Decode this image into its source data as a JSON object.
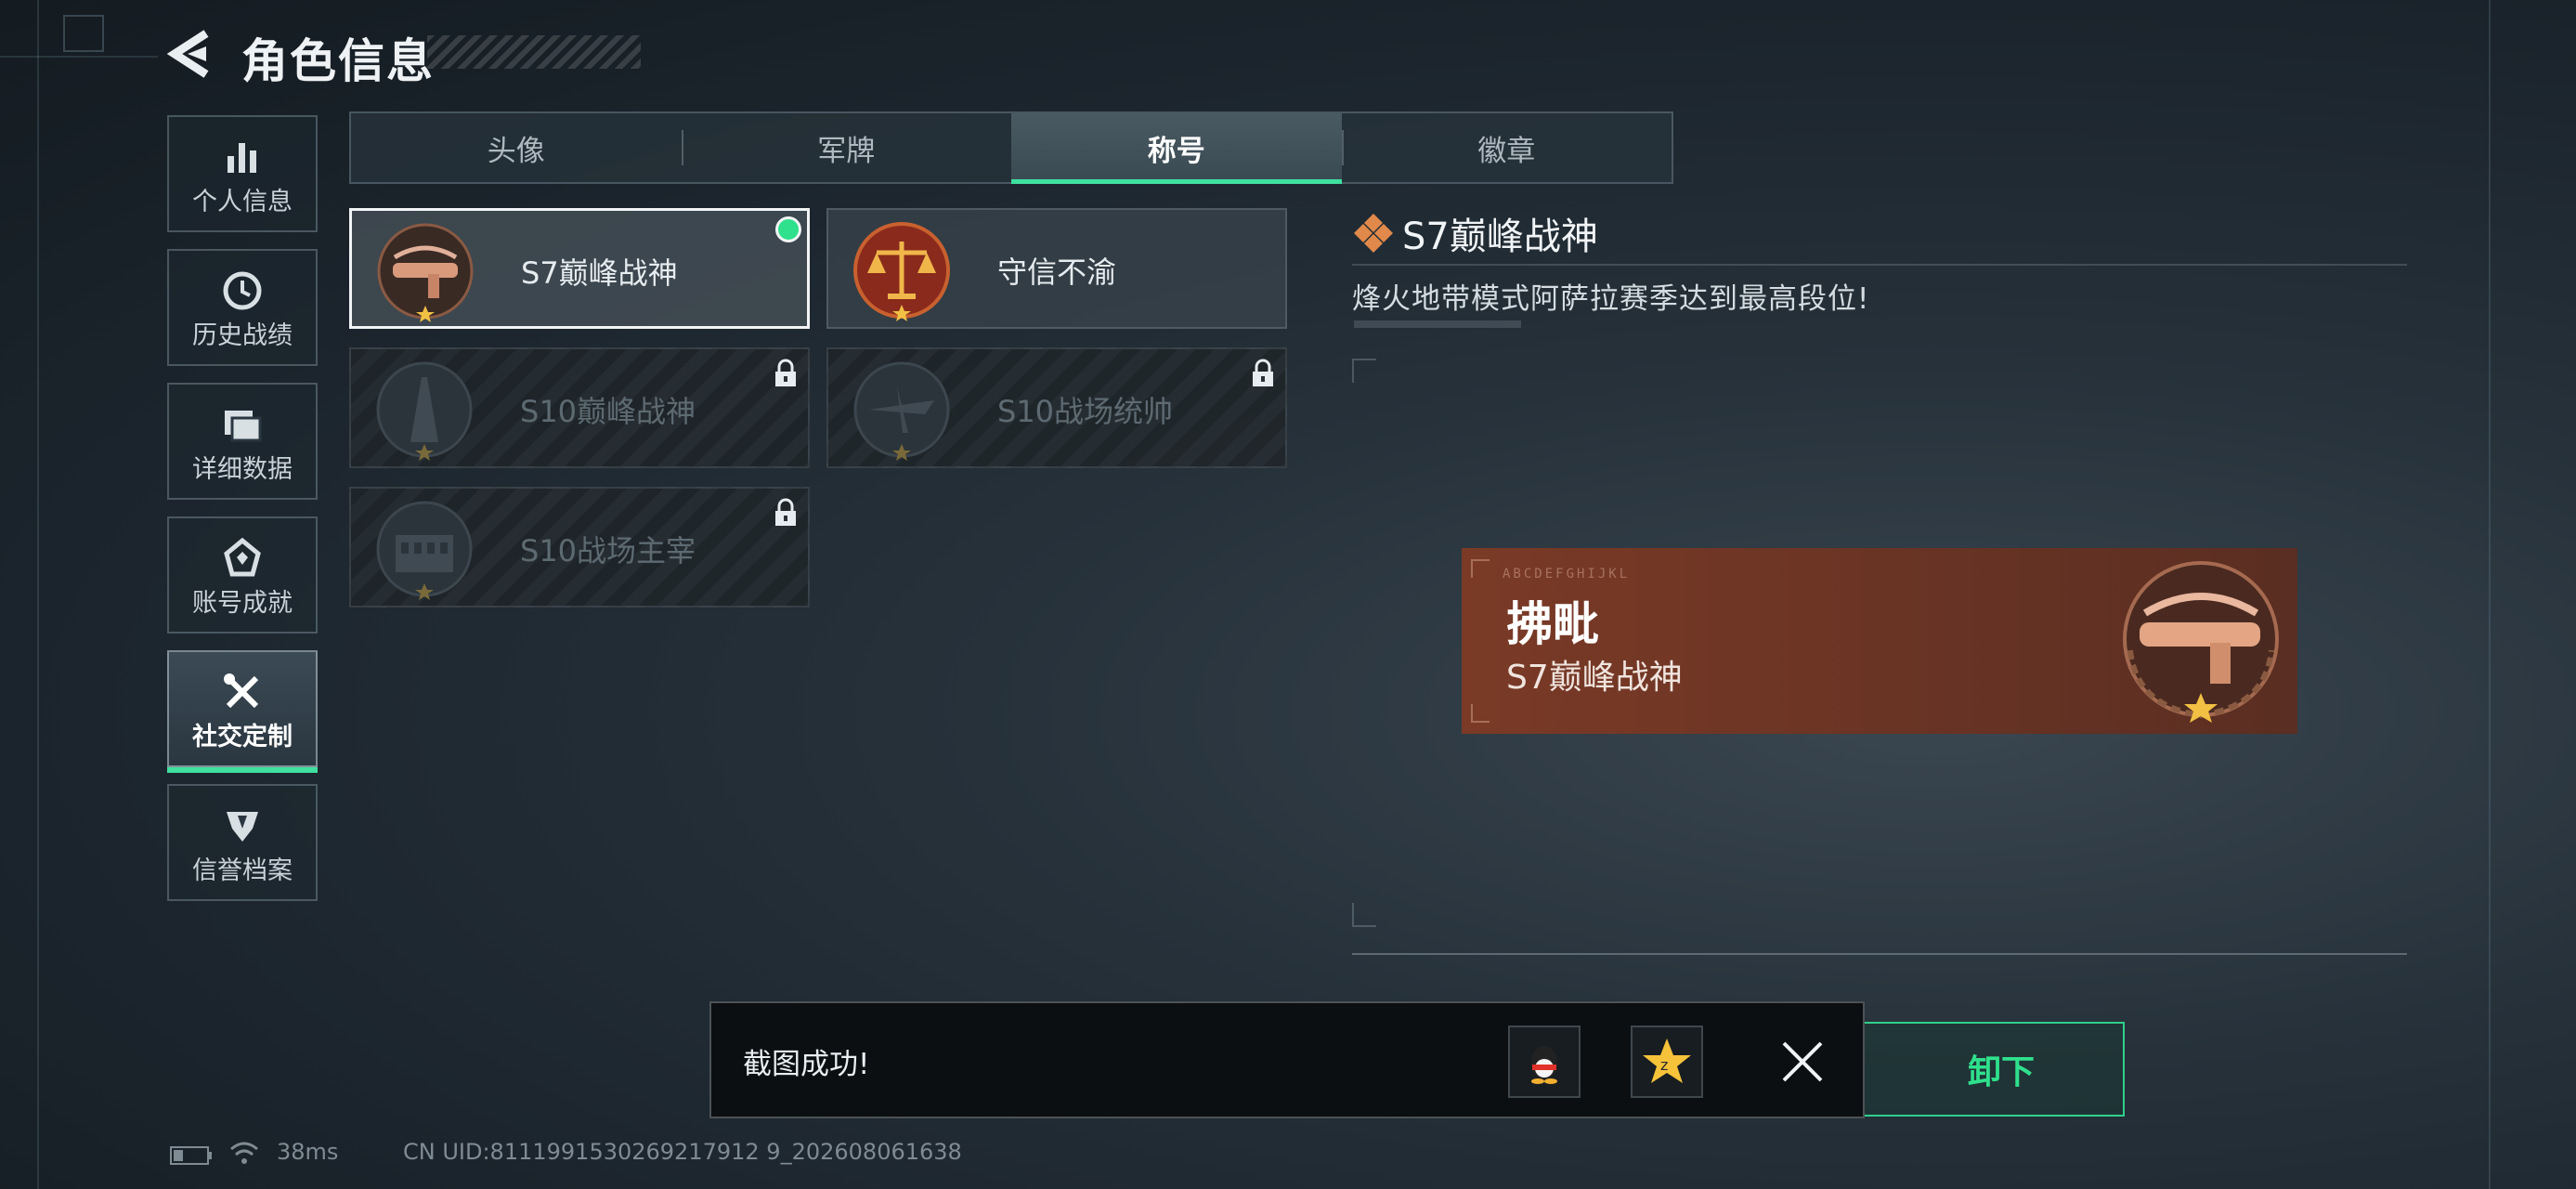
{
  "header": {
    "title": "角色信息"
  },
  "sidebar": {
    "items": [
      {
        "label": "个人信息",
        "icon": "bar-chart-icon"
      },
      {
        "label": "历史战绩",
        "icon": "clock-icon"
      },
      {
        "label": "详细数据",
        "icon": "folder-icon"
      },
      {
        "label": "账号成就",
        "icon": "achievement-icon"
      },
      {
        "label": "社交定制",
        "icon": "tools-icon",
        "active": true
      },
      {
        "label": "信誉档案",
        "icon": "shield-icon"
      }
    ]
  },
  "tabs": [
    {
      "label": "头像"
    },
    {
      "label": "军牌"
    },
    {
      "label": "称号",
      "active": true
    },
    {
      "label": "徽章"
    }
  ],
  "titles": [
    {
      "name": "S7巅峰战神",
      "state": "selected-equipped",
      "emblem": "crossbow-emblem-icon"
    },
    {
      "name": "守信不渝",
      "state": "unlocked",
      "emblem": "scales-emblem-icon"
    },
    {
      "name": "S10巅峰战神",
      "state": "locked",
      "emblem": "tower-emblem-icon"
    },
    {
      "name": "S10战场统帅",
      "state": "locked",
      "emblem": "aircraft-emblem-icon"
    },
    {
      "name": "S10战场主宰",
      "state": "locked",
      "emblem": "colosseum-emblem-icon"
    }
  ],
  "detail": {
    "title": "S7巅峰战神",
    "description": "烽火地带模式阿萨拉赛季达到最高段位!"
  },
  "banner": {
    "player_name": "拂毗",
    "title": "S7巅峰战神",
    "code_text": "ABCDEFGHIJKL"
  },
  "actions": {
    "unload_label": "卸下"
  },
  "toast": {
    "message": "截图成功!",
    "share_icons": [
      "qq-icon",
      "qzone-star-icon"
    ]
  },
  "status": {
    "ping": "38ms",
    "uid": "CN UID:8111991530269217912 9_202608061638"
  },
  "colors": {
    "accent": "#2fe08c",
    "banner": "#7a3a26",
    "background": "#1b242c"
  }
}
